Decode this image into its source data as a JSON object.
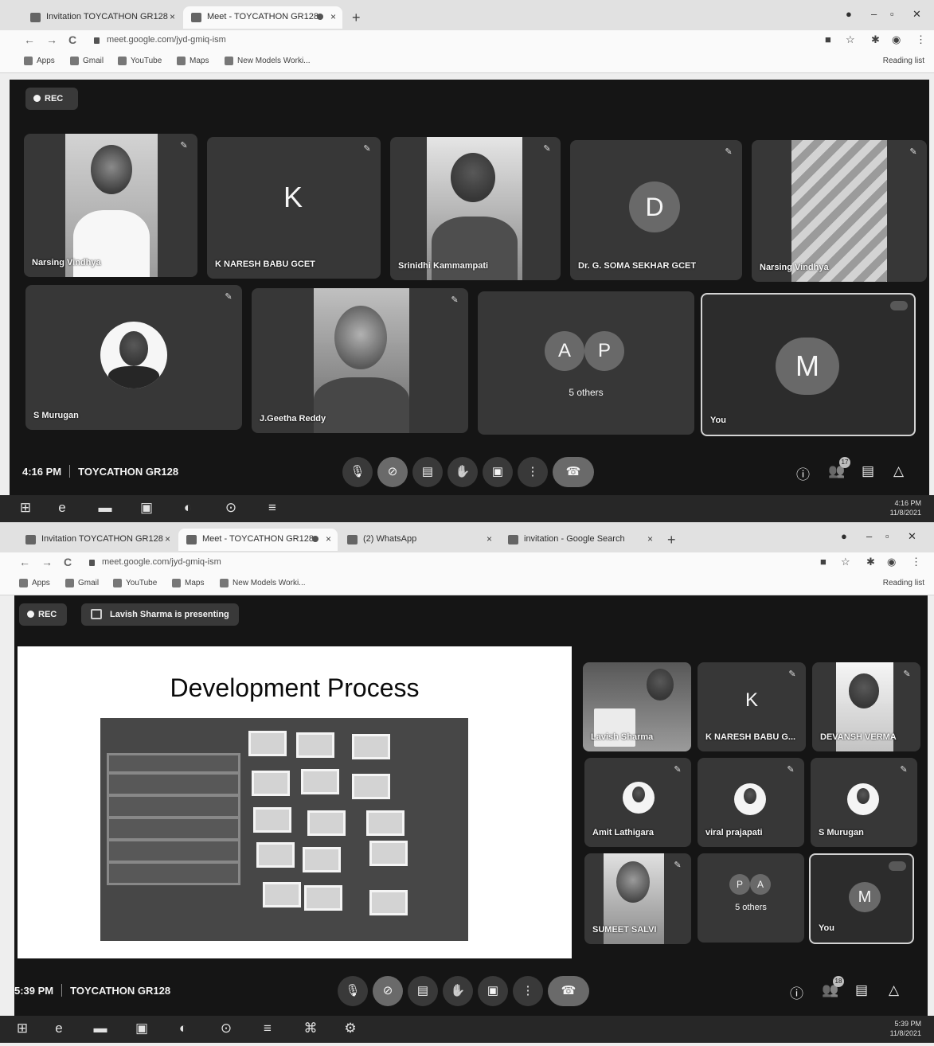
{
  "screens": [
    {
      "tabs": [
        {
          "label": "Invitation TOYCATHON GR128"
        },
        {
          "label": "Meet - TOYCATHON GR128"
        }
      ],
      "url": "meet.google.com/jyd-gmiq-ism",
      "bookmarks": [
        "Apps",
        "Gmail",
        "YouTube",
        "Maps",
        "New Models Worki..."
      ],
      "reading_list": "Reading list",
      "rec": "REC",
      "participants": [
        {
          "name": "Narsing Vindhya",
          "kind": "photo"
        },
        {
          "name": "K NARESH BABU GCET",
          "kind": "letter",
          "letter": "K"
        },
        {
          "name": "Srinidhi Kammampati",
          "kind": "photo"
        },
        {
          "name": "Dr. G. SOMA SEKHAR GCET",
          "kind": "letter",
          "letter": "D"
        },
        {
          "name": "Narsing Vindhya",
          "kind": "photo"
        },
        {
          "name": "S Murugan",
          "kind": "photo"
        },
        {
          "name": "J.Geetha Reddy",
          "kind": "photo"
        },
        {
          "name": "5 others",
          "kind": "others",
          "letters": [
            "A",
            "P"
          ]
        },
        {
          "name": "You",
          "kind": "letter",
          "letter": "M"
        }
      ],
      "time": "4:16 PM",
      "meeting": "TOYCATHON GR128",
      "people_count": "17",
      "clock": [
        "4:16 PM",
        "11/8/2021"
      ]
    },
    {
      "tabs": [
        {
          "label": "Invitation TOYCATHON GR128"
        },
        {
          "label": "Meet - TOYCATHON GR128"
        },
        {
          "label": "(2) WhatsApp"
        },
        {
          "label": "invitation - Google Search"
        }
      ],
      "url": "meet.google.com/jyd-gmiq-ism",
      "bookmarks": [
        "Apps",
        "Gmail",
        "YouTube",
        "Maps",
        "New Models Worki..."
      ],
      "reading_list": "Reading list",
      "rec": "REC",
      "presenting": "Lavish Sharma is presenting",
      "slide_title": "Development Process",
      "participants": [
        {
          "name": "Lavish Sharma",
          "kind": "photo"
        },
        {
          "name": "K NARESH BABU G...",
          "kind": "letter",
          "letter": "K"
        },
        {
          "name": "DEVANSH VERMA",
          "kind": "photo"
        },
        {
          "name": "Amit Lathigara",
          "kind": "photo"
        },
        {
          "name": "viral prajapati",
          "kind": "photo"
        },
        {
          "name": "S Murugan",
          "kind": "photo"
        },
        {
          "name": "SUMEET SALVI",
          "kind": "photo"
        },
        {
          "name": "5 others",
          "kind": "others",
          "letters": [
            "P",
            "A"
          ]
        },
        {
          "name": "You",
          "kind": "letter",
          "letter": "M"
        }
      ],
      "time": "5:39 PM",
      "meeting": "TOYCATHON GR128",
      "people_count": "18",
      "clock": [
        "5:39 PM",
        "11/8/2021"
      ]
    }
  ],
  "icons": {
    "back": "←",
    "forward": "→",
    "reload": "C",
    "mic": "🎙",
    "camera_off": "⊘",
    "captions": "▤",
    "hand": "✋",
    "present": "▣",
    "more": "⋮",
    "hangup": "☎",
    "info": "ⓘ",
    "people": "👥",
    "chat": "▤",
    "activities": "△"
  }
}
